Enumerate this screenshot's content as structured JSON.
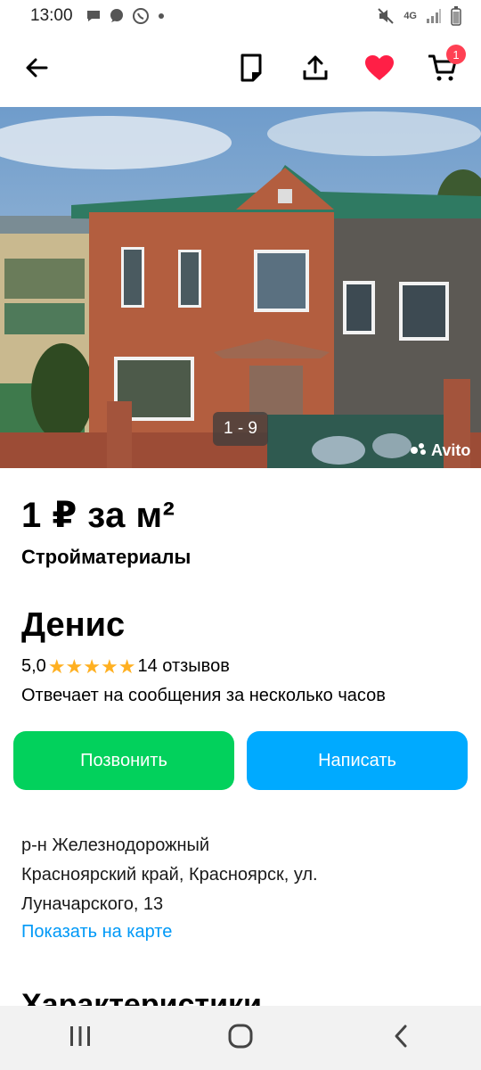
{
  "status_bar": {
    "time": "13:00",
    "network": "4G"
  },
  "toolbar": {
    "cart_count": "1"
  },
  "photo": {
    "counter": "1 - 9",
    "watermark": "Avito"
  },
  "listing": {
    "price": "1 ₽ за м²",
    "category": "Стройматериалы"
  },
  "seller": {
    "name": "Денис",
    "rating": "5,0",
    "reviews": "14 отзывов",
    "response_time": "Отвечает на сообщения за несколько часов"
  },
  "actions": {
    "call_label": "Позвонить",
    "message_label": "Написать"
  },
  "location": {
    "line1": "р-н Железнодорожный",
    "line2": "Красноярский край, Красноярск, ул.",
    "line3": "Луначарского, 13",
    "map_link": "Показать на карте"
  },
  "section": {
    "title": "Характеристики"
  },
  "colors": {
    "call": "#02d15c",
    "message": "#00aaff",
    "favorite": "#ff1f46",
    "link": "#0099f7",
    "star": "#ffb021"
  }
}
